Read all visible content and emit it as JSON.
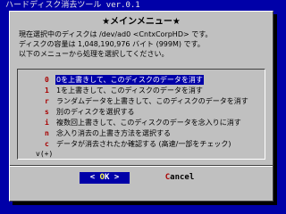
{
  "backtitle": "ハードディスク消去ツール ver.0.1",
  "dialog": {
    "title": "★メインメニュー★",
    "prompt_lines": [
      "現在選択中のディスクは /dev/ad0 <CntxCorpHD> です。",
      "ディスクの容量は 1,048,190,976 バイト (999M) です。",
      "以下のメニューから処理を選択してください。"
    ],
    "menu_more_top": "",
    "menu_more_bottom": "v(+)",
    "menu_items": [
      {
        "tag": "0",
        "label": "0を上書きして、このディスクのデータを消す",
        "selected": true
      },
      {
        "tag": "1",
        "label": "1を上書きして、このディスクのデータを消す",
        "selected": false
      },
      {
        "tag": "r",
        "label": "ランダムデータを上書きして、このディスクのデータを消す",
        "selected": false
      },
      {
        "tag": "s",
        "label": "別のディスクを選択する",
        "selected": false
      },
      {
        "tag": "i",
        "label": "複数回上書きして、このディスクのデータを念入りに消す",
        "selected": false
      },
      {
        "tag": "n",
        "label": "念入り消去の上書き方法を選択する",
        "selected": false
      },
      {
        "tag": "c",
        "label": "データが消去されたか確認する (高速/一部をチェック)",
        "selected": false
      }
    ],
    "ok_button": {
      "hot": "O",
      "rest": "K"
    },
    "cancel_button": {
      "hot": "C",
      "rest": "ancel"
    }
  }
}
